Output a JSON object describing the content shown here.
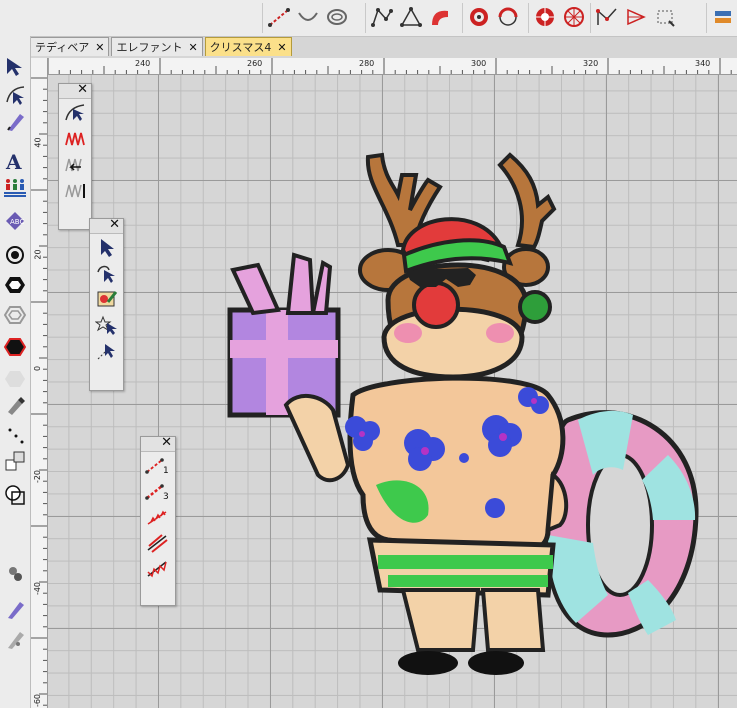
{
  "colors": {
    "accent": "#fbe08a",
    "toolbar_bg": "#ececec",
    "canvas_bg": "#d6d6d6"
  },
  "tabs": [
    {
      "label": "テディベア",
      "close": "✕",
      "active": false
    },
    {
      "label": "エレファント",
      "close": "✕",
      "active": false
    },
    {
      "label": "クリスマス4",
      "close": "✕",
      "active": true
    }
  ],
  "ruler": {
    "h_labels": [
      "240",
      "260",
      "280",
      "300",
      "320",
      "340"
    ],
    "v_labels": [
      "40",
      "20",
      "0",
      "-20",
      "-40",
      "-60"
    ]
  },
  "palettes": {
    "close_glyph": "✕",
    "stitch_count_1": "1",
    "stitch_count_3": "3"
  },
  "icons": {
    "top": [
      "line-tool-icon",
      "arc-tool-icon",
      "circle-tool-icon",
      "polygon-tool-icon",
      "shape-tool-icon",
      "curve-tool-icon",
      "donut-tool-icon",
      "node-tool-icon",
      "star-tool-icon",
      "zigzag-tool-icon",
      "arrow-shape-icon",
      "transform-tool-icon",
      "settings-tool-icon"
    ],
    "left": [
      "select-arrow-icon",
      "node-edit-icon",
      "pen-icon",
      "text-tool-icon",
      "people-icon",
      "monogram-icon",
      "spiral-icon",
      "hexagon-icon",
      "outline-icon",
      "red-hexagon-icon",
      "fill-icon",
      "color-picker-icon",
      "dot-icon",
      "split-icon",
      "layer-icon",
      "stamp-icon",
      "needle-icon",
      "pencil-icon"
    ]
  }
}
